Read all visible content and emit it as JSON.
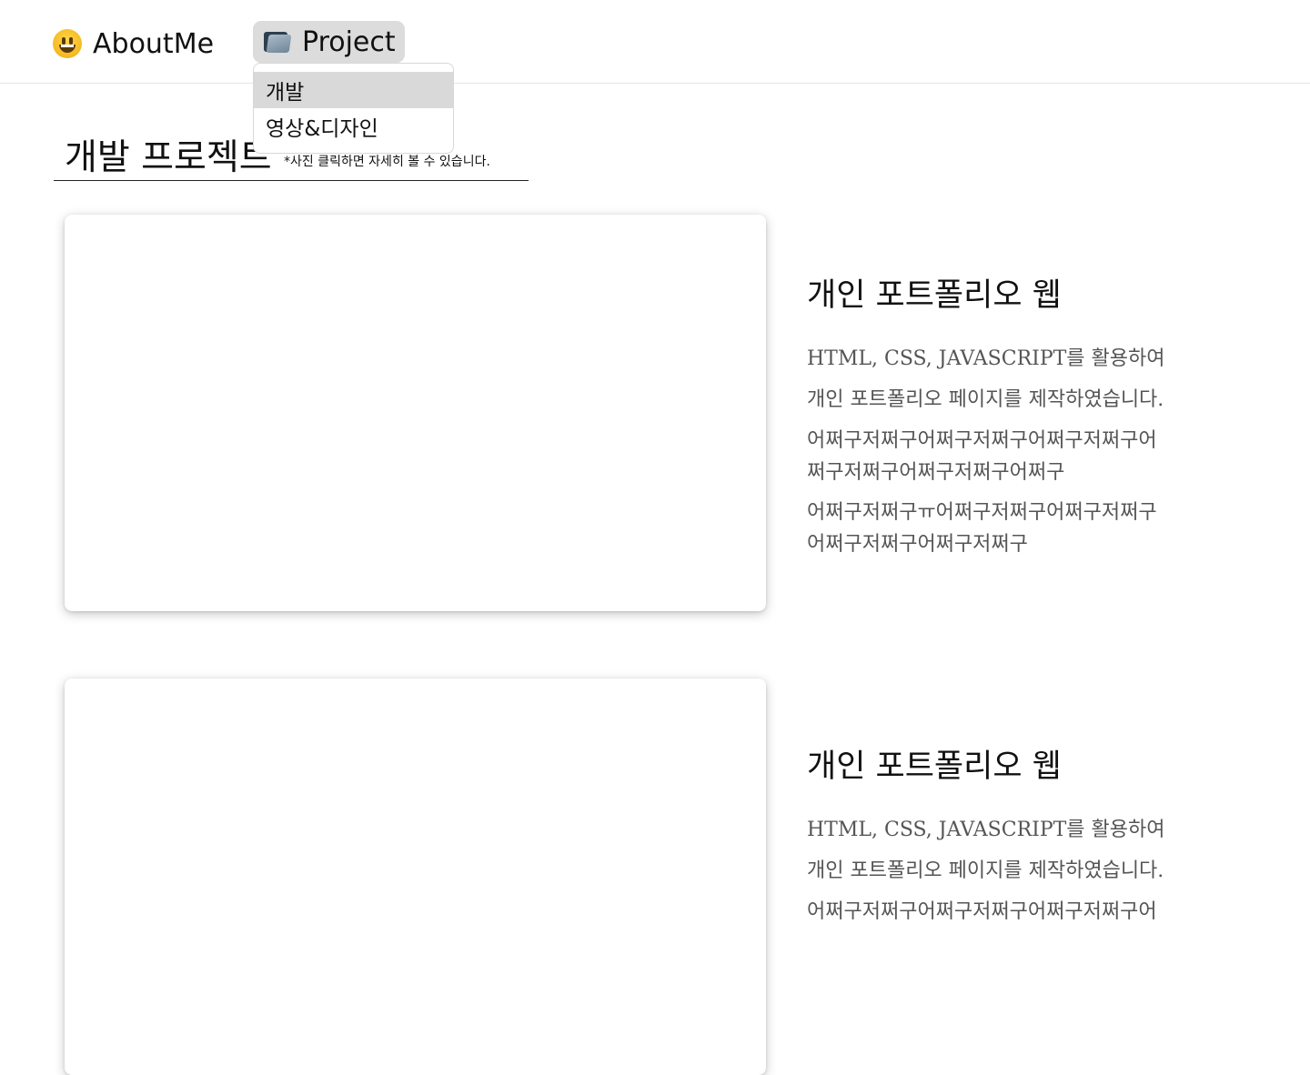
{
  "nav": {
    "aboutme_label": "AboutMe",
    "aboutme_icon": "grinning-face-icon",
    "project_label": "Project",
    "project_icon": "folder-icon"
  },
  "dropdown": {
    "items": [
      "개발",
      "영상&디자인"
    ],
    "selected": "개발"
  },
  "section": {
    "title": "개발 프로젝트",
    "note": "*사진 클릭하면 자세히 볼 수 있습니다."
  },
  "projects": [
    {
      "title": "개인 포트폴리오 웹",
      "desc1": "HTML, CSS, JAVASCRIPT를 활용하여",
      "desc2": "개인 포트폴리오 페이지를 제작하였습니다.",
      "desc3a": "어쩌구저쩌구어쩌구저쩌구어쩌구저쩌구어",
      "desc3b": "쩌구저쩌구어쩌구저쩌구어쩌구",
      "desc4a": "어쩌구저쩌구ㅠ어쩌구저쩌구어쩌구저쩌구",
      "desc4b": "어쩌구저쩌구어쩌구저쩌구"
    },
    {
      "title": "개인 포트폴리오 웹",
      "desc1": "HTML, CSS, JAVASCRIPT를 활용하여",
      "desc2": "개인 포트폴리오 페이지를 제작하였습니다.",
      "desc3a": "어쩌구저쩌구어쩌구저쩌구어쩌구저쩌구어"
    }
  ],
  "colors": {
    "project_button_bg": "#dcdcdc",
    "dropdown_selected_bg": "#d9d9d9",
    "description_text": "#555555"
  }
}
